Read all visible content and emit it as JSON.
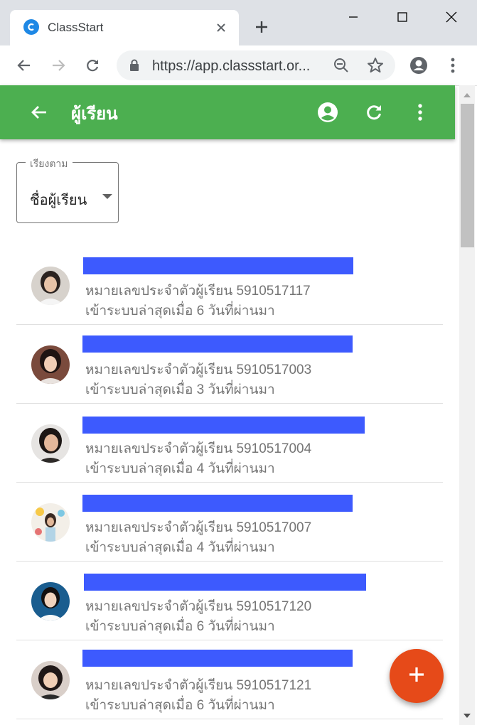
{
  "browser": {
    "tab_title": "ClassStart",
    "url": "https://app.classstart.or..."
  },
  "appbar": {
    "title": "ผู้เรียน"
  },
  "sort": {
    "label": "เรียงตาม",
    "value": "ชื่อผู้เรียน"
  },
  "students": [
    {
      "id_text": "หมายเลขประจำตัวผู้เรียน 5910517117",
      "last_login": "เข้าระบบล่าสุดเมื่อ 6 วันที่ผ่านมา"
    },
    {
      "id_text": "หมายเลขประจำตัวผู้เรียน 5910517003",
      "last_login": "เข้าระบบล่าสุดเมื่อ 3 วันที่ผ่านมา"
    },
    {
      "id_text": "หมายเลขประจำตัวผู้เรียน 5910517004",
      "last_login": "เข้าระบบล่าสุดเมื่อ 4 วันที่ผ่านมา"
    },
    {
      "id_text": "หมายเลขประจำตัวผู้เรียน 5910517007",
      "last_login": "เข้าระบบล่าสุดเมื่อ 4 วันที่ผ่านมา"
    },
    {
      "id_text": "หมายเลขประจำตัวผู้เรียน 5910517120",
      "last_login": "เข้าระบบล่าสุดเมื่อ 6 วันที่ผ่านมา"
    },
    {
      "id_text": "หมายเลขประจำตัวผู้เรียน 5910517121",
      "last_login": "เข้าระบบล่าสุดเมื่อ 6 วันที่ผ่านมา"
    }
  ],
  "icons": {
    "back": "arrow-back-icon",
    "account": "account-circle-icon",
    "refresh": "refresh-icon",
    "more": "more-vert-icon",
    "add": "add-icon"
  },
  "colors": {
    "appbar": "#4caf50",
    "redaction": "#3d5afe",
    "fab": "#e64a19"
  }
}
